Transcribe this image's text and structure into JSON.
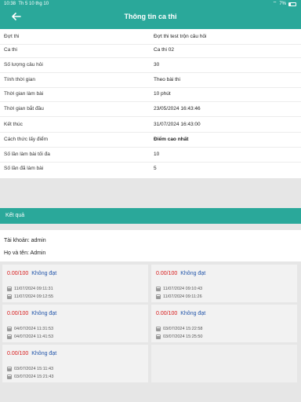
{
  "status_bar": {
    "time": "10:38",
    "date": "Th 5 10 thg 10",
    "battery": "7%"
  },
  "header": {
    "title": "Thông tin ca thi"
  },
  "info": [
    {
      "label": "Đợt thi",
      "value": "Đợt thi test trộn câu hỏi"
    },
    {
      "label": "Ca thi",
      "value": "Ca thi 02"
    },
    {
      "label": "Số lượng câu hỏi",
      "value": "30"
    },
    {
      "label": "Tính thời gian",
      "value": "Theo bài thi"
    },
    {
      "label": "Thời gian làm bài",
      "value": "10 phút"
    },
    {
      "label": "Thời gian bắt đầu",
      "value": "23/05/2024 16:43:46"
    },
    {
      "label": "Kết thúc",
      "value": "31/07/2024 16:43:00"
    },
    {
      "label": "Cách thức lấy điểm",
      "value": "Điểm cao nhất"
    },
    {
      "label": "Số lần làm bài tối đa",
      "value": "10"
    },
    {
      "label": "Số lần đã làm bài",
      "value": "5"
    }
  ],
  "results": {
    "title": "Kết quả",
    "account_line": "Tài khoản: admin",
    "name_line": "Họ và tên: Admin",
    "attempts": [
      {
        "score": "0.00/100",
        "status": "Không đạt",
        "start": "11/07/2024 09:11:31",
        "end": "11/07/2024 09:12:55"
      },
      {
        "score": "0.00/100",
        "status": "Không đạt",
        "start": "11/07/2024 09:10:43",
        "end": "11/07/2024 09:11:26"
      },
      {
        "score": "0.00/100",
        "status": "Không đạt",
        "start": "04/07/2024 11:31:53",
        "end": "04/07/2024 11:41:53"
      },
      {
        "score": "0.00/100",
        "status": "Không đạt",
        "start": "03/07/2024 15:22:58",
        "end": "03/07/2024 15:25:50"
      },
      {
        "score": "0.00/100",
        "status": "Không đạt",
        "start": "03/07/2024 15:11:43",
        "end": "03/07/2024 15:21:43"
      }
    ]
  },
  "colors": {
    "header": "#2aa89a",
    "fail_score": "#d81b1b",
    "fail_status": "#2255aa"
  }
}
